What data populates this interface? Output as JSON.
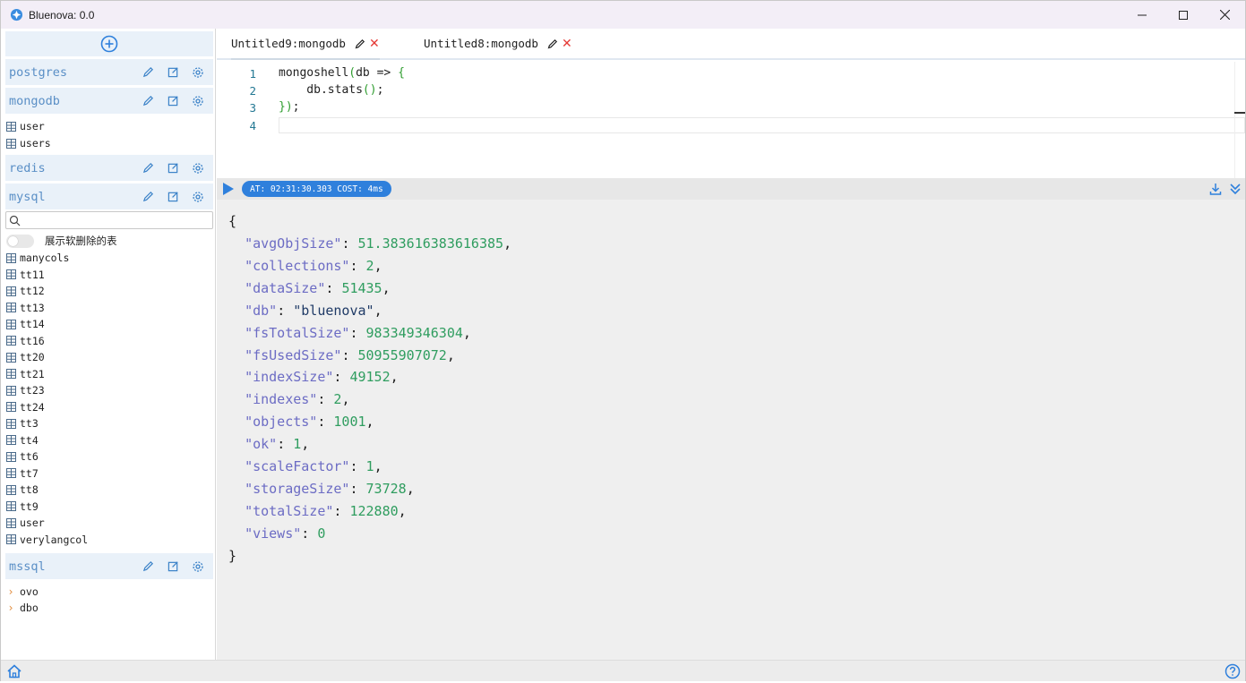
{
  "window": {
    "title": "Bluenova: 0.0"
  },
  "sidebar": {
    "connections": [
      {
        "name": "postgres"
      },
      {
        "name": "mongodb",
        "items": [
          "user",
          "users"
        ]
      },
      {
        "name": "redis"
      },
      {
        "name": "mysql",
        "search_placeholder": "",
        "toggle_label": "展示软删除的表",
        "items": [
          "manycols",
          "tt11",
          "tt12",
          "tt13",
          "tt14",
          "tt16",
          "tt20",
          "tt21",
          "tt23",
          "tt24",
          "tt3",
          "tt4",
          "tt6",
          "tt7",
          "tt8",
          "tt9",
          "user",
          "verylangcol"
        ]
      },
      {
        "name": "mssql",
        "schemas": [
          "ovo",
          "dbo"
        ]
      }
    ]
  },
  "tabs": [
    {
      "label": "Untitled9:mongodb",
      "active": true
    },
    {
      "label": "Untitled8:mongodb",
      "active": false
    }
  ],
  "editor": {
    "line_numbers": [
      "1",
      "2",
      "3",
      "4"
    ],
    "lines": {
      "l1_a": "mongoshell",
      "l1_b": "(",
      "l1_c": "db => ",
      "l1_d": "{",
      "l2": "    db.stats",
      "l2_b": "()",
      "l2_c": ";",
      "l3_a": "}",
      "l3_b": ")",
      "l3_c": ";"
    }
  },
  "result": {
    "badge": "AT: 02:31:30.303 COST: 4ms",
    "open_brace": "{",
    "close_brace": "}",
    "entries": [
      {
        "key": "\"avgObjSize\"",
        "value": "51.383616383616385",
        "type": "num",
        "comma": ","
      },
      {
        "key": "\"collections\"",
        "value": "2",
        "type": "num",
        "comma": ","
      },
      {
        "key": "\"dataSize\"",
        "value": "51435",
        "type": "num",
        "comma": ","
      },
      {
        "key": "\"db\"",
        "value": "\"bluenova\"",
        "type": "str",
        "comma": ","
      },
      {
        "key": "\"fsTotalSize\"",
        "value": "983349346304",
        "type": "num",
        "comma": ","
      },
      {
        "key": "\"fsUsedSize\"",
        "value": "50955907072",
        "type": "num",
        "comma": ","
      },
      {
        "key": "\"indexSize\"",
        "value": "49152",
        "type": "num",
        "comma": ","
      },
      {
        "key": "\"indexes\"",
        "value": "2",
        "type": "num",
        "comma": ","
      },
      {
        "key": "\"objects\"",
        "value": "1001",
        "type": "num",
        "comma": ","
      },
      {
        "key": "\"ok\"",
        "value": "1",
        "type": "num",
        "comma": ","
      },
      {
        "key": "\"scaleFactor\"",
        "value": "1",
        "type": "num",
        "comma": ","
      },
      {
        "key": "\"storageSize\"",
        "value": "73728",
        "type": "num",
        "comma": ","
      },
      {
        "key": "\"totalSize\"",
        "value": "122880",
        "type": "num",
        "comma": ","
      },
      {
        "key": "\"views\"",
        "value": "0",
        "type": "num",
        "comma": ""
      }
    ]
  },
  "colors": {
    "accent": "#2f80dc",
    "connection_text": "#5a8fc6",
    "json_key": "#6c6cc4",
    "json_number": "#2f9d5f",
    "close_red": "#e53935"
  }
}
